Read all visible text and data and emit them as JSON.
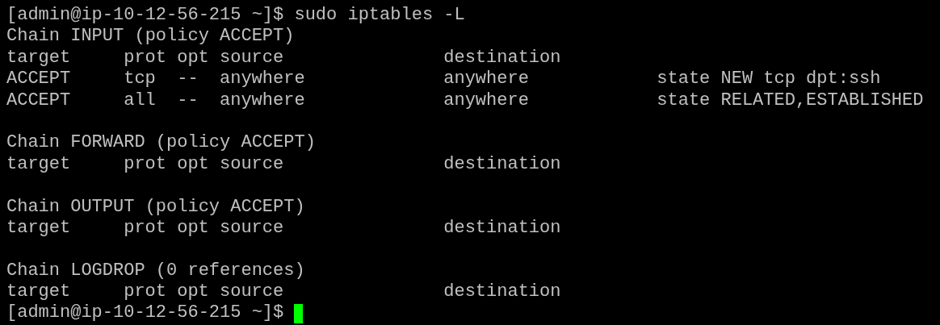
{
  "terminal": {
    "lines": [
      {
        "kind": "prompt",
        "prompt": "[admin@ip-10-12-56-215 ~]$",
        "command": "sudo iptables -L",
        "cursor": false
      },
      {
        "kind": "chain",
        "text": "Chain INPUT (policy ACCEPT)"
      },
      {
        "kind": "header",
        "cells": [
          "target",
          "prot",
          "opt",
          "source",
          "destination"
        ]
      },
      {
        "kind": "rule",
        "cells": [
          "ACCEPT",
          "tcp",
          "--",
          "anywhere",
          "anywhere",
          "state NEW tcp dpt:ssh"
        ]
      },
      {
        "kind": "rule",
        "cells": [
          "ACCEPT",
          "all",
          "--",
          "anywhere",
          "anywhere",
          "state RELATED,ESTABLISHED"
        ]
      },
      {
        "kind": "blank"
      },
      {
        "kind": "chain",
        "text": "Chain FORWARD (policy ACCEPT)"
      },
      {
        "kind": "header",
        "cells": [
          "target",
          "prot",
          "opt",
          "source",
          "destination"
        ]
      },
      {
        "kind": "blank"
      },
      {
        "kind": "chain",
        "text": "Chain OUTPUT (policy ACCEPT)"
      },
      {
        "kind": "header",
        "cells": [
          "target",
          "prot",
          "opt",
          "source",
          "destination"
        ]
      },
      {
        "kind": "blank"
      },
      {
        "kind": "chain",
        "text": "Chain LOGDROP (0 references)"
      },
      {
        "kind": "header",
        "cells": [
          "target",
          "prot",
          "opt",
          "source",
          "destination"
        ]
      },
      {
        "kind": "prompt",
        "prompt": "[admin@ip-10-12-56-215 ~]$",
        "cursor": true
      }
    ]
  }
}
